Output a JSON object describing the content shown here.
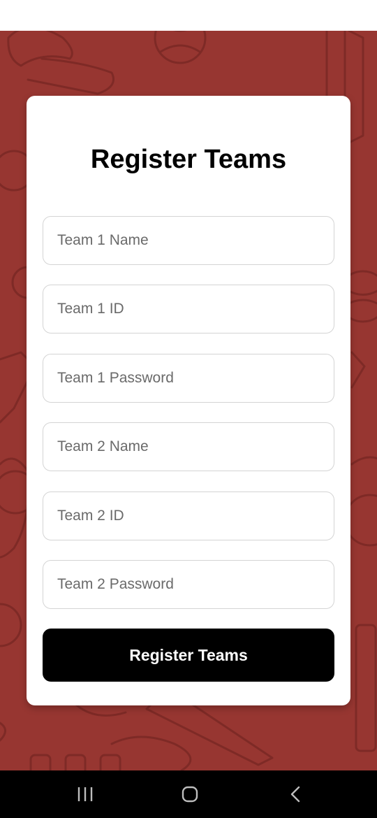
{
  "form": {
    "title": "Register Teams",
    "fields": [
      {
        "placeholder": "Team 1 Name",
        "value": ""
      },
      {
        "placeholder": "Team 1 ID",
        "value": ""
      },
      {
        "placeholder": "Team 1 Password",
        "value": ""
      },
      {
        "placeholder": "Team 2 Name",
        "value": ""
      },
      {
        "placeholder": "Team 2 ID",
        "value": ""
      },
      {
        "placeholder": "Team 2 Password",
        "value": ""
      }
    ],
    "submit_label": "Register Teams"
  },
  "theme": {
    "background": "#973631",
    "pattern_stroke": "#7e2a26",
    "card": "#ffffff",
    "button": "#000000",
    "button_text": "#ffffff"
  },
  "navigation": {
    "icons": [
      "recent-apps-icon",
      "home-icon",
      "back-icon"
    ]
  }
}
